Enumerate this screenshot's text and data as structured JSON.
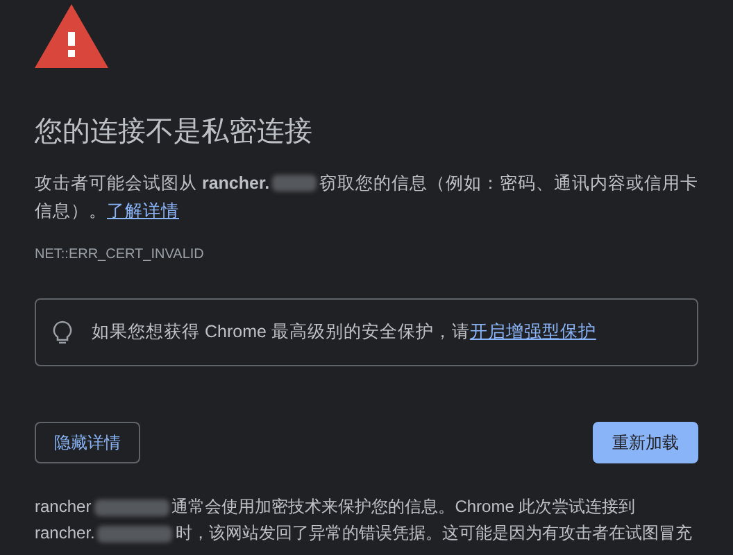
{
  "title": "您的连接不是私密连接",
  "intro": {
    "before": "攻击者可能会试图从 **rancher.**",
    "after": "窃取您的信息（例如：密码、通讯内容或信用卡",
    "after_line2": "信息）。",
    "link": "了解详情"
  },
  "error_code": "NET::ERR_CERT_INVALID",
  "tip": {
    "text": "如果您想获得 Chrome 最高级别的安全保护，请",
    "link": "开启增强型保护"
  },
  "buttons": [
    {
      "label": "隐藏详情",
      "kind": "secondary"
    },
    {
      "label": "重新加载",
      "kind": "primary"
    }
  ],
  "details": [
    {
      "host": "rancher",
      "text": "通常会使用加密技术来保护您的信息。Chrome 此次尝试连接到"
    },
    {
      "host": "rancher.",
      "text": "时，该网站发回了异常的错误凭据。这可能是因为有攻击者在试图冒充"
    }
  ]
}
